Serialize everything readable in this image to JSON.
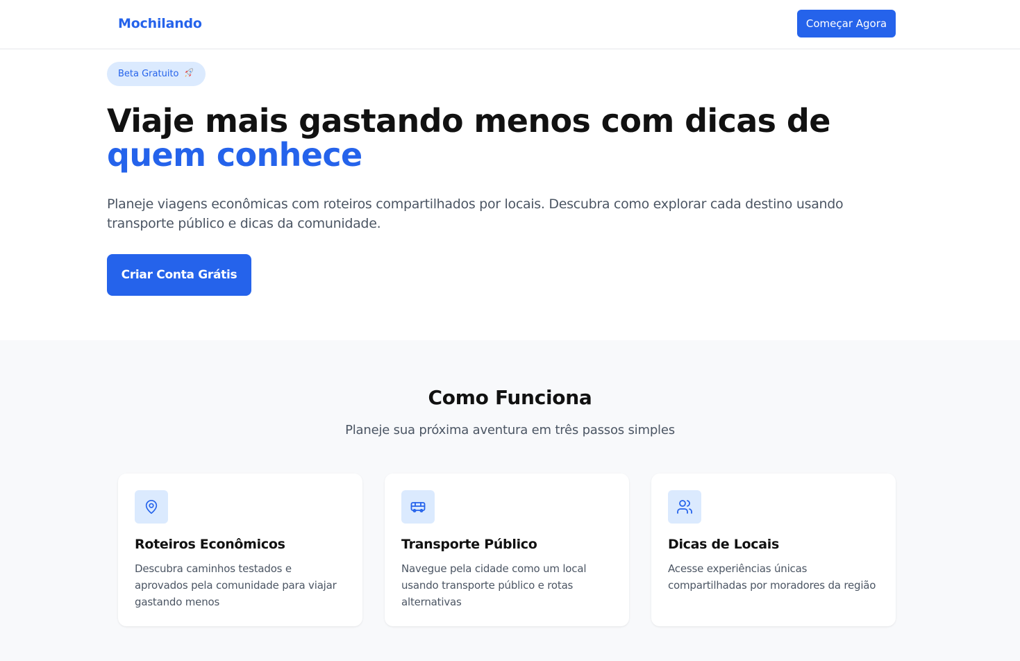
{
  "header": {
    "brand": "Mochilando",
    "cta_label": "Começar Agora"
  },
  "hero": {
    "badge_label": "Beta Gratuito",
    "badge_icon": "rocket-icon",
    "title_main": "Viaje mais gastando menos com dicas de ",
    "title_accent": "quem conhece",
    "subtitle": "Planeje viagens econômicas com roteiros compartilhados por locais. Descubra como explorar cada destino usando transporte público e dicas da comunidade.",
    "cta_label": "Criar Conta Grátis"
  },
  "how_it_works": {
    "title": "Como Funciona",
    "subtitle": "Planeje sua próxima aventura em três passos simples",
    "cards": [
      {
        "icon": "map-pin-icon",
        "title": "Roteiros Econômicos",
        "text": "Descubra caminhos testados e aprovados pela comunidade para viajar gastando menos"
      },
      {
        "icon": "bus-icon",
        "title": "Transporte Público",
        "text": "Navegue pela cidade como um local usando transporte público e rotas alternativas"
      },
      {
        "icon": "users-icon",
        "title": "Dicas de Locais",
        "text": "Acesse experiências únicas compartilhadas por moradores da região"
      }
    ]
  },
  "colors": {
    "accent": "#2563eb",
    "accent_light": "#dbeafe",
    "section_bg": "#f8f9fb",
    "text_muted": "#4b5563"
  }
}
